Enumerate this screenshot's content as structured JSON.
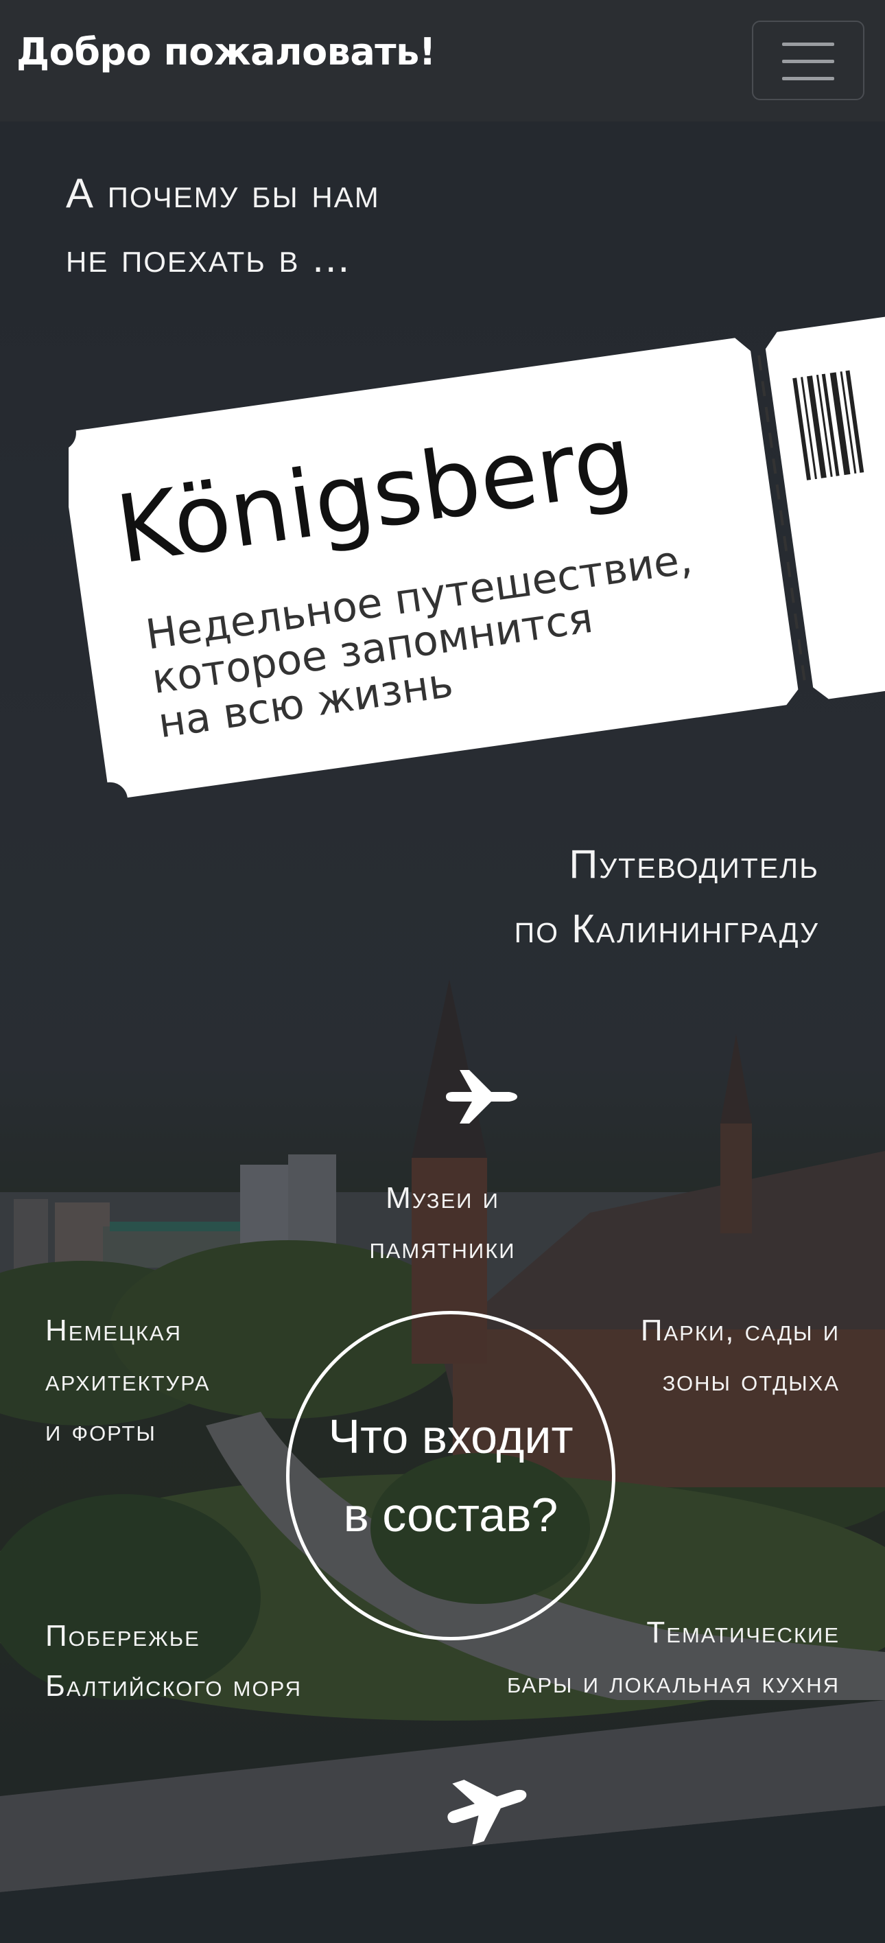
{
  "navbar": {
    "brand": "Добро пожаловать!",
    "menu_icon": "hamburger-menu-icon"
  },
  "hero": {
    "intro_line1": "А почему бы нам",
    "intro_line2": "не поехать в ...",
    "ticket": {
      "title": "Königsberg",
      "subtitle_line1": "Недельное путешествие,",
      "subtitle_line2": "которое запомнится",
      "subtitle_line3": "на всю жизнь"
    },
    "guide_line1": "Путеводитель",
    "guide_line2": "по Калининграду",
    "plane_icon": "airplane-icon",
    "center_line1": "Что входит",
    "center_line2": "в состав?",
    "topics": {
      "museums_line1": "Музеи и",
      "museums_line2": "памятники",
      "german_line1": "Немецкая",
      "german_line2": "архитектура",
      "german_line3": "и форты",
      "parks_line1": "Парки, сады и",
      "parks_line2": "зоны отдыха",
      "coast_line1": "Побережье",
      "coast_line2": "Балтийского моря",
      "bars_line1": "Тематические",
      "bars_line2": "бары и локальная кухня"
    }
  },
  "colors": {
    "navbar_bg": "#2b2e32",
    "text": "#ffffff",
    "ticket": "#ffffff"
  }
}
